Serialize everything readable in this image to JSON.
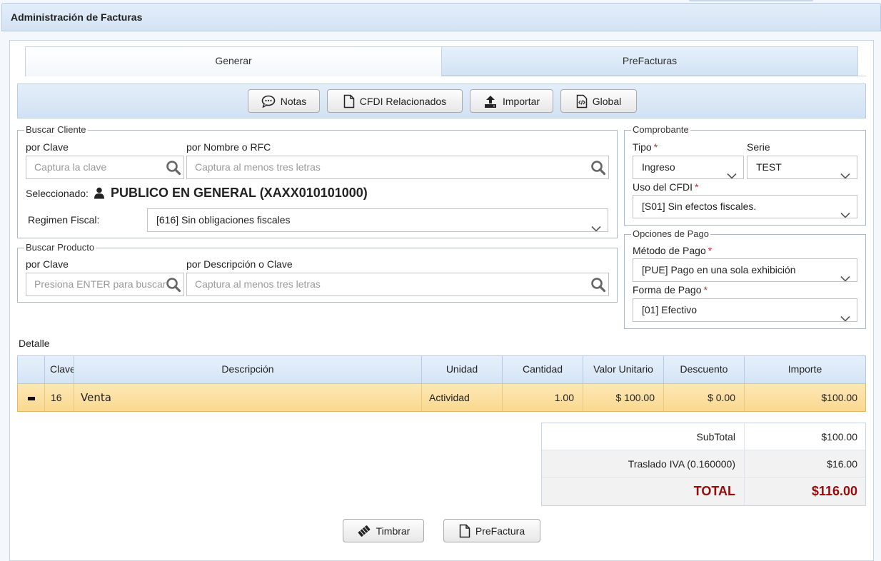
{
  "window": {
    "title": "Administración de Facturas"
  },
  "tabs": [
    {
      "label": "Generar",
      "active": true
    },
    {
      "label": "PreFacturas",
      "active": false
    }
  ],
  "toolbar": {
    "notas": "Notas",
    "cfdi": "CFDI Relacionados",
    "importar": "Importar",
    "global": "Global"
  },
  "cliente": {
    "legend": "Buscar Cliente",
    "clave_label": "por Clave",
    "clave_placeholder": "Captura la clave",
    "nombre_label": "por Nombre o RFC",
    "nombre_placeholder": "Captura al menos tres letras",
    "seleccionado_label": "Seleccionado:",
    "seleccionado_value": "PUBLICO EN GENERAL (XAXX010101000)",
    "regimen_label": "Regimen Fiscal:",
    "regimen_value": "[616] Sin obligaciones fiscales"
  },
  "producto": {
    "legend": "Buscar Producto",
    "clave_label": "por Clave",
    "clave_placeholder": "Presiona ENTER para buscar",
    "desc_label": "por Descripción o Clave",
    "desc_placeholder": "Captura al menos tres letras"
  },
  "comprobante": {
    "legend": "Comprobante",
    "tipo_label": "Tipo",
    "tipo_value": "Ingreso",
    "serie_label": "Serie",
    "serie_value": "TEST",
    "uso_label": "Uso del CFDI",
    "uso_value": "[S01] Sin efectos fiscales."
  },
  "pago": {
    "legend": "Opciones de Pago",
    "metodo_label": "Método de Pago",
    "metodo_value": "[PUE] Pago en una sola exhibición",
    "forma_label": "Forma de Pago",
    "forma_value": "[01] Efectivo"
  },
  "detalle": {
    "title": "Detalle",
    "columns": [
      "Clave",
      "Descripción",
      "Unidad",
      "Cantidad",
      "Valor Unitario",
      "Descuento",
      "Importe"
    ],
    "rows": [
      {
        "clave": "16",
        "descripcion": "Venta",
        "unidad": "Actividad",
        "cantidad": "1.00",
        "valor_unitario": "$ 100.00",
        "descuento": "$ 0.00",
        "importe": "$100.00"
      }
    ]
  },
  "totales": {
    "subtotal_label": "SubTotal",
    "subtotal_value": "$100.00",
    "iva_label": "Traslado IVA (0.160000)",
    "iva_value": "$16.00",
    "total_label": "TOTAL",
    "total_value": "$116.00"
  },
  "actions": {
    "timbrar": "Timbrar",
    "prefactura": "PreFactura"
  },
  "colors": {
    "header_bg": "#d3e2f3",
    "row_selected": "#fad98f",
    "total_red": "#9b0a0a",
    "required_star": "#d9252a"
  }
}
